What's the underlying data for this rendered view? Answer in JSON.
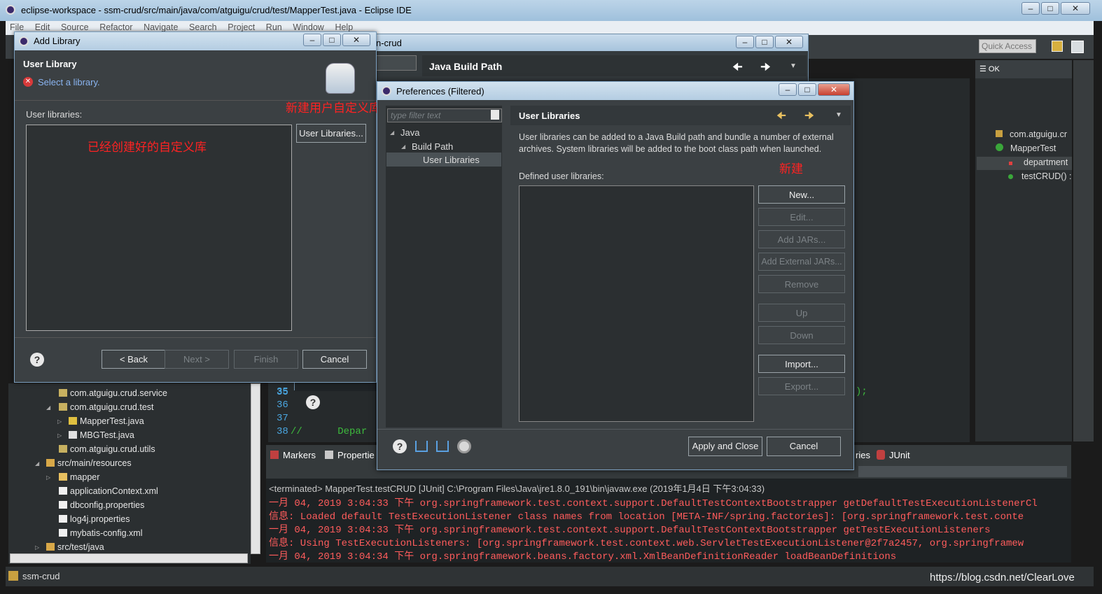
{
  "window": {
    "title": "eclipse-workspace - ssm-crud/src/main/java/com/atguigu/crud/test/MapperTest.java - Eclipse IDE",
    "menu": [
      "File",
      "Edit",
      "Source",
      "Refactor",
      "Navigate",
      "Search",
      "Project",
      "Run",
      "Window",
      "Help"
    ],
    "quick_access": "Quick Access"
  },
  "java_build_path": {
    "title_suffix": "n-crud",
    "header": "Java Build Path",
    "line_numbers": [
      "35",
      "36",
      "37",
      "38"
    ],
    "code_line_38": "//      Depar",
    "code_tail": ");"
  },
  "add_library": {
    "title": "Add Library",
    "header_title": "User Library",
    "header_message": "Select a library.",
    "list_label": "User libraries:",
    "user_libraries_button": "User Libraries...",
    "back_button": "< Back",
    "next_button": "Next >",
    "finish_button": "Finish",
    "cancel_button": "Cancel",
    "annotation_existing": "已经创建好的自定义库",
    "annotation_new": "新建用户自定义库"
  },
  "preferences": {
    "title": "Preferences (Filtered)",
    "filter_placeholder": "type filter text",
    "tree": [
      "Java",
      "Build Path",
      "User Libraries"
    ],
    "page_title": "User Libraries",
    "description": "User libraries can be added to a Java Build path and bundle a number of external archives. System libraries will be added to the boot class path when launched.",
    "defined_label": "Defined user libraries:",
    "annotation_new": "新建",
    "buttons": {
      "new": "New...",
      "edit": "Edit...",
      "add_jars": "Add JARs...",
      "add_external_jars": "Add External JARs...",
      "remove": "Remove",
      "up": "Up",
      "down": "Down",
      "import": "Import...",
      "export": "Export..."
    },
    "apply_close": "Apply and Close",
    "cancel": "Cancel"
  },
  "package_explorer": {
    "items": [
      "com.atguigu.crud.service",
      "com.atguigu.crud.test",
      "MapperTest.java",
      "MBGTest.java",
      "com.atguigu.crud.utils",
      "src/main/resources",
      "mapper",
      "applicationContext.xml",
      "dbconfig.properties",
      "log4j.properties",
      "mybatis-config.xml",
      "src/test/java"
    ]
  },
  "outline": {
    "items": [
      "com.atguigu.cr",
      "MapperTest",
      "department",
      "testCRUD() :"
    ]
  },
  "console": {
    "tabs": [
      "Markers",
      "Propertie",
      "ries",
      "JUnit"
    ],
    "terminated": "<terminated> MapperTest.testCRUD [JUnit] C:\\Program Files\\Java\\jre1.8.0_191\\bin\\javaw.exe (2019年1月4日 下午3:04:33)",
    "lines": [
      "一月 04, 2019 3:04:33 下午 org.springframework.test.context.support.DefaultTestContextBootstrapper getDefaultTestExecutionListenerCl",
      "信息: Loaded default TestExecutionListener class names from location [META-INF/spring.factories]: [org.springframework.test.conte",
      "一月 04, 2019 3:04:33 下午 org.springframework.test.context.support.DefaultTestContextBootstrapper getTestExecutionListeners",
      "信息: Using TestExecutionListeners: [org.springframework.test.context.web.ServletTestExecutionListener@2f7a2457, org.springframew",
      "一月 04, 2019 3:04:34 下午 org.springframework.beans.factory.xml.XmlBeanDefinitionReader loadBeanDefinitions"
    ]
  },
  "status": {
    "project": "ssm-crud",
    "watermark": "https://blog.csdn.net/ClearLove"
  },
  "colors": {
    "annotation": "#ff2222",
    "console_error": "#ff5c5c",
    "titlebar": "#b4cde2"
  }
}
